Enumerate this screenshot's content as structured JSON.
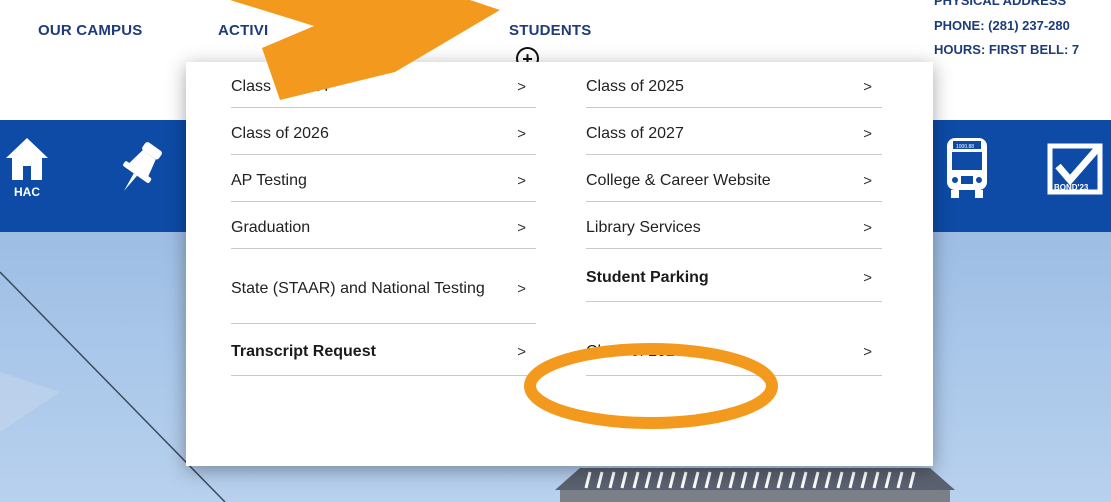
{
  "nav": {
    "our_campus": "OUR CAMPUS",
    "activities": "ACTIVI",
    "students": "STUDENTS",
    "plus_symbol": "+"
  },
  "contact": {
    "top_line": "PHYSICAL ADDRESS",
    "phone": "PHONE: (281) 237-280",
    "hours": "HOURS: FIRST BELL: 7"
  },
  "iconbar": {
    "hac_label": "HAC",
    "bus_label": "1000.88",
    "bond_label": "BOND'23"
  },
  "dropdown": {
    "left_column": [
      {
        "label": "Class of 2024",
        "bold": false
      },
      {
        "label": "Class of 2026",
        "bold": false
      },
      {
        "label": "AP Testing",
        "bold": false
      },
      {
        "label": "Graduation",
        "bold": false
      },
      {
        "label": "State (STAAR) and National Testing",
        "bold": false
      },
      {
        "label": "Transcript Request",
        "bold": true
      }
    ],
    "right_column": [
      {
        "label": "Class of 2025",
        "bold": false
      },
      {
        "label": "Class of 2027",
        "bold": false
      },
      {
        "label": "College & Career Website",
        "bold": false
      },
      {
        "label": "Library Services",
        "bold": false
      },
      {
        "label": "Student Parking",
        "bold": true
      },
      {
        "label": "Class of 2028",
        "bold": false
      }
    ],
    "chevron": ">"
  },
  "colors": {
    "nav_text": "#1d3c78",
    "icon_bar": "#0d4ba6",
    "highlight_orange": "#f39a1e"
  }
}
